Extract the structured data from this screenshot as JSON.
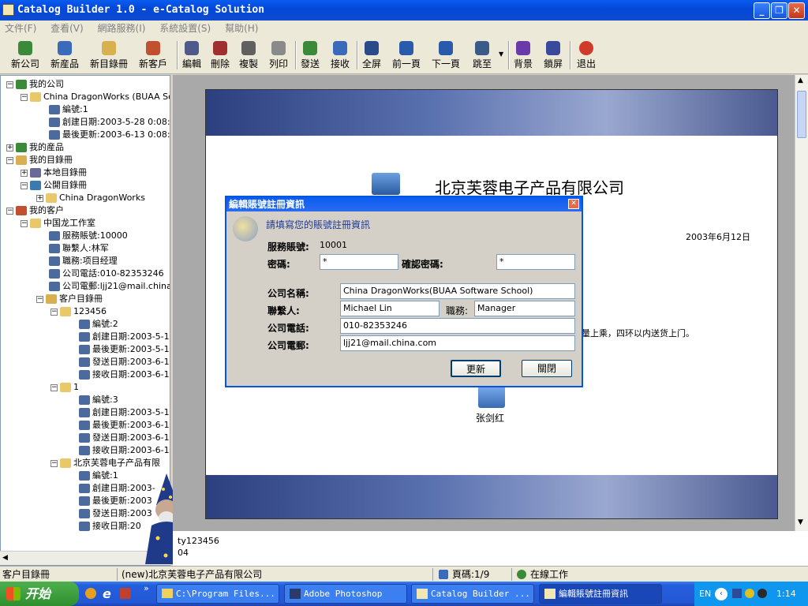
{
  "window": {
    "title": "Catalog Builder 1.0 - e-Catalog Solution"
  },
  "menu": [
    "文件(F)",
    "查看(V)",
    "網路服務(I)",
    "系統設置(S)",
    "幫助(H)"
  ],
  "toolbar": [
    {
      "label": "新公司",
      "icon": "globe-icon"
    },
    {
      "label": "新産品",
      "icon": "globe-icon"
    },
    {
      "label": "新目錄冊",
      "icon": "catalog-icon"
    },
    {
      "label": "新客戶",
      "icon": "people-icon"
    },
    {
      "label": "編輯",
      "icon": "edit-icon"
    },
    {
      "label": "刪除",
      "icon": "delete-icon"
    },
    {
      "label": "複製",
      "icon": "copy-icon"
    },
    {
      "label": "列印",
      "icon": "print-icon"
    },
    {
      "label": "發送",
      "icon": "send-icon"
    },
    {
      "label": "接收",
      "icon": "receive-icon"
    },
    {
      "label": "全屏",
      "icon": "fullscreen-icon"
    },
    {
      "label": "前一頁",
      "icon": "prev-page-icon"
    },
    {
      "label": "下一頁",
      "icon": "next-page-icon"
    },
    {
      "label": "跳至",
      "icon": "jump-icon"
    },
    {
      "label": "背景",
      "icon": "background-icon"
    },
    {
      "label": "鎖屏",
      "icon": "lock-icon"
    },
    {
      "label": "退出",
      "icon": "exit-icon"
    }
  ],
  "tree": [
    {
      "text": "我的公司",
      "pm": "−",
      "icon": "globe-icon"
    },
    {
      "text": "China DragonWorks (BUAA Sof",
      "pm": "−",
      "icon": "folder-icon"
    },
    {
      "text": "編號:1",
      "icon": "info-icon"
    },
    {
      "text": "創建日期:2003-5-28 0:08:2",
      "icon": "info-icon"
    },
    {
      "text": "最後更新:2003-6-13 0:08:5",
      "icon": "info-icon"
    },
    {
      "text": "我的産品",
      "pm": "+",
      "icon": "globe-icon"
    },
    {
      "text": "我的目錄冊",
      "pm": "−",
      "icon": "catalog-icon"
    },
    {
      "text": "本地目錄冊",
      "pm": "+",
      "icon": "local-catalog-icon"
    },
    {
      "text": "公開目錄冊",
      "pm": "−",
      "icon": "public-catalog-icon"
    },
    {
      "text": "China DragonWorks",
      "pm": "+",
      "icon": "folder-icon"
    },
    {
      "text": "我的客户",
      "pm": "−",
      "icon": "people-icon"
    },
    {
      "text": "中国龙工作室",
      "pm": "−",
      "icon": "folder-icon"
    },
    {
      "text": "服務賬號:10000",
      "icon": "info-icon"
    },
    {
      "text": "聯繫人:林军",
      "icon": "info-icon"
    },
    {
      "text": "職務:项目经理",
      "icon": "info-icon"
    },
    {
      "text": "公司電話:010-82353246",
      "icon": "info-icon"
    },
    {
      "text": "公司電郵:ljj21@mail.china.c",
      "icon": "info-icon"
    },
    {
      "text": "客户目錄冊",
      "pm": "−",
      "icon": "catalog-icon"
    },
    {
      "text": "123456",
      "pm": "−",
      "icon": "folder-icon"
    },
    {
      "text": "編號:2",
      "icon": "info-icon"
    },
    {
      "text": "創建日期:2003-5-1",
      "icon": "info-icon"
    },
    {
      "text": "最後更新:2003-5-1",
      "icon": "info-icon"
    },
    {
      "text": "發送日期:2003-6-1",
      "icon": "info-icon"
    },
    {
      "text": "接收日期:2003-6-1",
      "icon": "info-icon"
    },
    {
      "text": "1",
      "pm": "−",
      "icon": "folder-icon"
    },
    {
      "text": "編號:3",
      "icon": "info-icon"
    },
    {
      "text": "創建日期:2003-5-1",
      "icon": "info-icon"
    },
    {
      "text": "最後更新:2003-6-1",
      "icon": "info-icon"
    },
    {
      "text": "發送日期:2003-6-1",
      "icon": "info-icon"
    },
    {
      "text": "接收日期:2003-6-1",
      "icon": "info-icon"
    },
    {
      "text": "北京芙蓉电子产品有限",
      "pm": "−",
      "icon": "folder-icon"
    },
    {
      "text": "編號:1",
      "icon": "info-icon"
    },
    {
      "text": "創建日期:2003-",
      "icon": "info-icon"
    },
    {
      "text": "最後更新:2003",
      "icon": "info-icon"
    },
    {
      "text": "發送日期:2003",
      "icon": "info-icon"
    },
    {
      "text": "接收日期:20",
      "icon": "info-icon"
    }
  ],
  "page": {
    "company": "北京芙蓉电子产品有限公司",
    "date": "2003年6月12日",
    "body_text": "量上乘，四环以内送货上门。",
    "contact_name": "张剑红"
  },
  "bottom_pane": {
    "line1": "ty123456",
    "line2": "04"
  },
  "dialog": {
    "title": "編輯賬號註冊資訊",
    "prompt": "請填寫您的賬號註冊資訊",
    "account_label": "服務賬號:",
    "account_value": "10001",
    "password_label": "密碼:",
    "password_value": "*",
    "confirm_label": "確認密碼:",
    "confirm_value": "*",
    "company_label": "公司名稱:",
    "company_value": "China DragonWorks(BUAA Software School)",
    "contact_label": "聯繫人:",
    "contact_value": "Michael Lin",
    "position_label": "職務:",
    "position_value": "Manager",
    "phone_label": "公司電話:",
    "phone_value": "010-82353246",
    "email_label": "公司電郵:",
    "email_value": "ljj21@mail.china.com",
    "update_button": "更新",
    "close_button": "關閉"
  },
  "status": {
    "left": "客户目錄冊",
    "middle": "(new)北京芙蓉电子产品有限公司",
    "page": "頁碼:1/9",
    "mode": "在線工作"
  },
  "taskbar": {
    "start": "开始",
    "tasks": [
      "C:\\Program Files...",
      "Adobe Photoshop",
      "Catalog Builder ...",
      "編輯賬號註冊資訊"
    ],
    "lang": "EN",
    "time": "1:14"
  },
  "colors": {
    "title_blue": "#0a5cf0",
    "taskbar_blue": "#245edb",
    "start_green": "#3c9a3c"
  }
}
